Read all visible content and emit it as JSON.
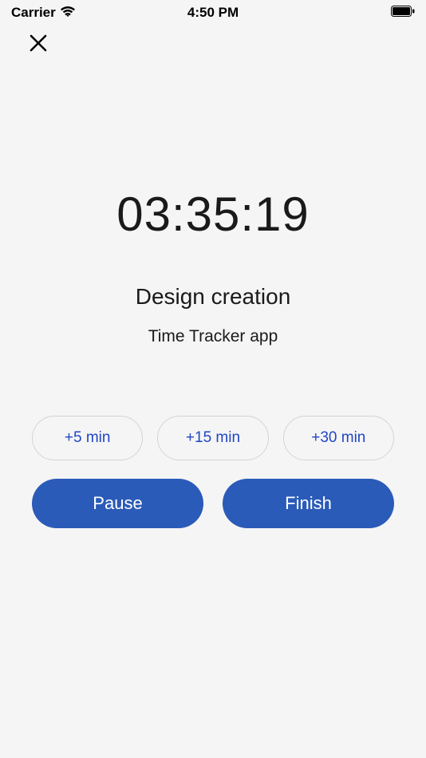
{
  "status": {
    "carrier": "Carrier",
    "time": "4:50 PM"
  },
  "timer": "03:35:19",
  "task": {
    "title": "Design creation",
    "app": "Time Tracker app"
  },
  "addButtons": [
    {
      "label": "+5 min"
    },
    {
      "label": "+15 min"
    },
    {
      "label": "+30 min"
    }
  ],
  "actions": {
    "pause": "Pause",
    "finish": "Finish"
  }
}
